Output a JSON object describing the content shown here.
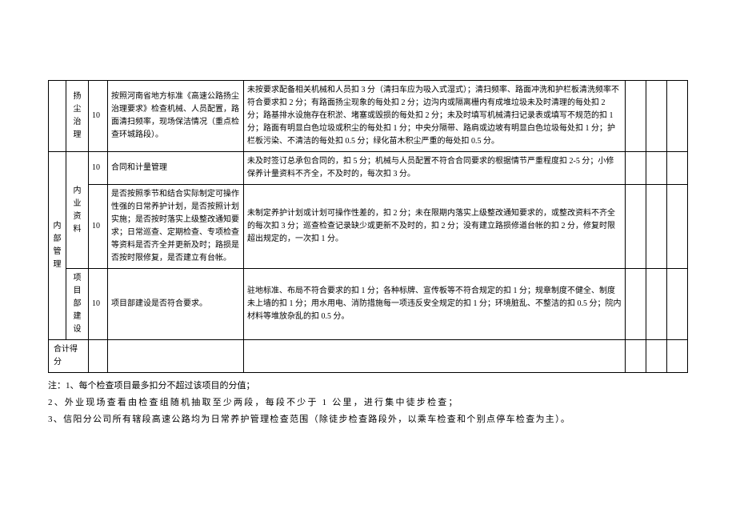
{
  "table": {
    "rows": [
      {
        "cat": "",
        "sub": "扬尘治理",
        "score": "10",
        "req": "按照河南省地方标准《高速公路扬尘治理要求》检查机械、人员配置，路面清扫频率，现场保洁情况（重点检查环城路段）。",
        "std": "未按要求配备相关机械和人员扣 3 分（清扫车应为吸入式湿式）；清扫频率、路面冲洗和护栏板清洗频率不符合要求扣 2 分；有路面扬尘现象的每处扣 2 分；边沟内或隔离栅内有成堆垃圾未及时清理的每处扣 2 分；路基排水设施存在积淤、堵塞或毁损的每处扣 2 分；未及时填写机械清扫记录表或填写不规范的扣 1 分；路面有明显白色垃圾或积尘的每处扣 1 分；中央分隔带、路肩或边坡有明显白色垃圾每处扣 1 分；护栏板污染、不清洁的每处扣 0.5 分；绿化苗木积尘严重的每处扣 0.5 分。"
      },
      {
        "cat": "内部管理",
        "sub": "内业资料",
        "score1": "10",
        "req1": "合同和计量管理",
        "std1": "未及时签订总承包合同的，扣 5 分；机械与人员配置不符合合同要求的根据情节严重程度扣 2-5 分；小修保养计量资料不齐全，不及时的，每次扣 3 分。",
        "score2": "10",
        "req2": "是否按照季节和结合实际制定可操作性强的日常养护计划，是否按照计划实施；是否按时落实上级整改通知要求；日常巡查、定期检查、专项检查等资料是否齐全并更新及时；路损是否按时限修复，是否建立有台帐。",
        "std2": "未制定养护计划或计划可操作性差的，扣 2 分；未在限期内落实上级整改通知要求的，或整改资料不齐全的每次扣 3 分；巡查检查记录缺少或更新不及时的，扣 2 分；没有建立路损修道台帐的扣 2 分，修复时限超出规定的，一次扣 1 分。"
      },
      {
        "cat": "",
        "sub": "项目部建设",
        "score": "10",
        "req": "项目部建设是否符合要求。",
        "std": "驻地标准、布局不符合要求的扣 1 分；各种标牌、宣传板等不符合规定的扣 1 分；规章制度不健全、制度未上墙的扣 1 分；用水用电、消防措施每一项违反安全规定的扣 1 分；环境脏乱、不整洁的扣 0.5 分；院内材料等堆放杂乱的扣 0.5 分。"
      }
    ],
    "total_label": "合计得分"
  },
  "notes": {
    "n1": "注：1、每个检查项目最多扣分不超过该项目的分值；",
    "n2": "2、外业现场查看由检查组随机抽取至少两段，每段不少于 1 公里，进行集中徒步检查；",
    "n3": "3、信阳分公司所有辖段高速公路均为日常养护管理检查范围（除徒步检查路段外，以乘车检查和个别点停车检查为主）。"
  }
}
